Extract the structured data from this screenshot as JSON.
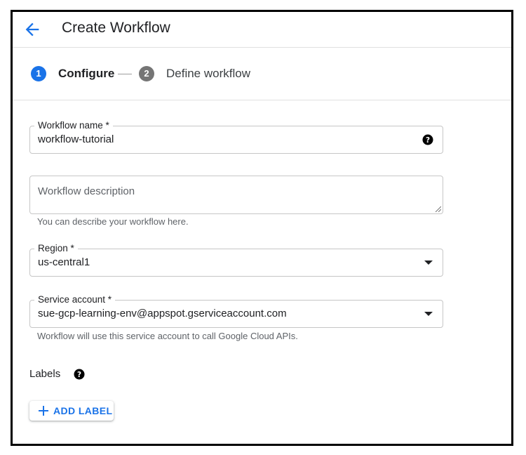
{
  "header": {
    "title": "Create Workflow"
  },
  "stepper": {
    "steps": [
      {
        "number": "1",
        "label": "Configure",
        "state": "active"
      },
      {
        "number": "2",
        "label": "Define workflow",
        "state": "inactive"
      }
    ]
  },
  "form": {
    "workflow_name": {
      "label": "Workflow name *",
      "value": "workflow-tutorial"
    },
    "workflow_description": {
      "placeholder": "Workflow description",
      "helper": "You can describe your workflow here."
    },
    "region": {
      "label": "Region *",
      "value": "us-central1"
    },
    "service_account": {
      "label": "Service account *",
      "value": "sue-gcp-learning-env@appspot.gserviceaccount.com",
      "helper": "Workflow will use this service account to call Google Cloud APIs."
    },
    "labels": {
      "title": "Labels",
      "add_button": "ADD LABEL"
    }
  },
  "colors": {
    "accent": "#1a73e8",
    "inactive_step": "#757575",
    "border": "#c6c6c6"
  },
  "icons": [
    "back-arrow-icon",
    "help-icon",
    "dropdown-arrow-icon",
    "plus-icon"
  ]
}
